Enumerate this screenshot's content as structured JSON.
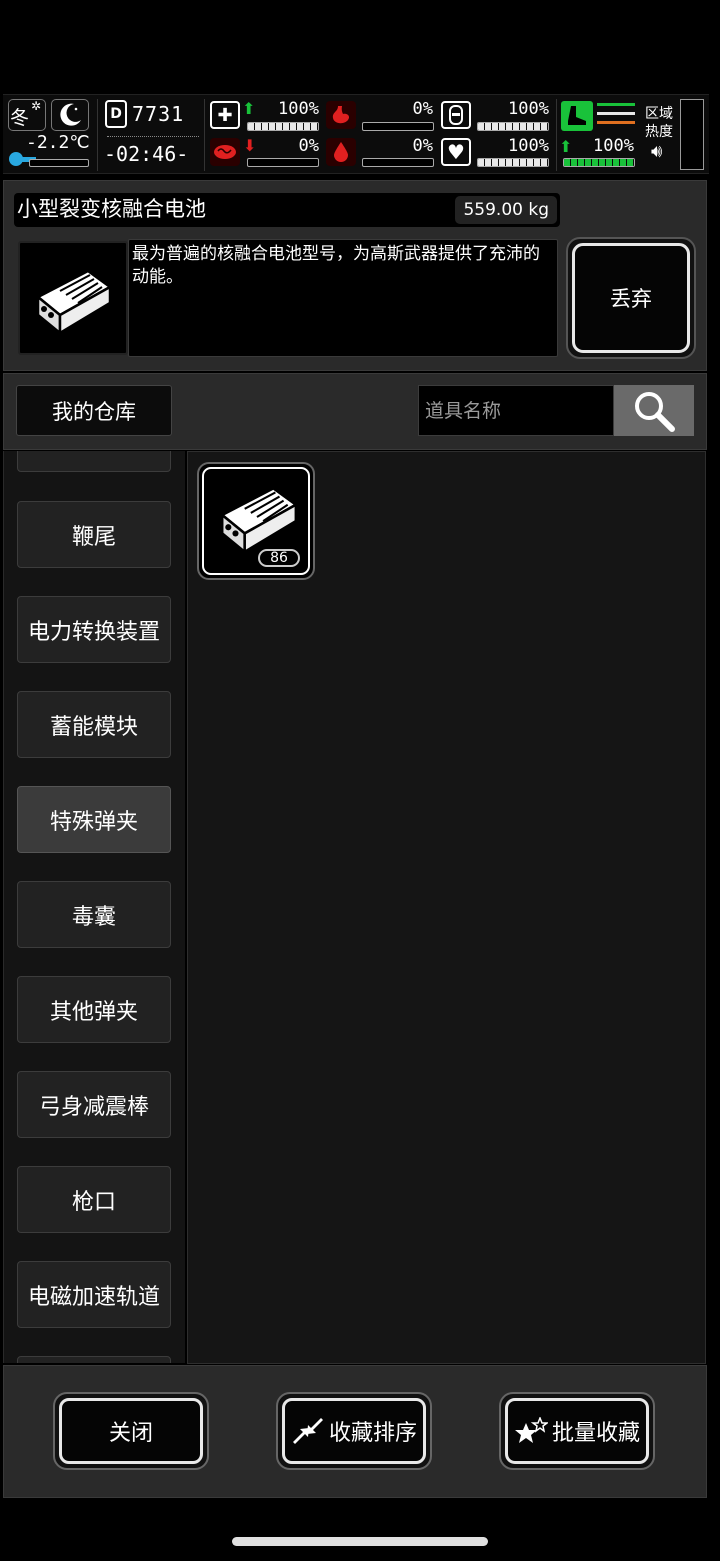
{
  "hud": {
    "season": "冬",
    "temperature": "-2.2℃",
    "day": "7731",
    "time": "-02:46-",
    "stats": {
      "health_pct": "100%",
      "hunger_pct": "0%",
      "hydration_pct": "100%",
      "brain_pct": "0%",
      "blood_pct": "0%",
      "heart_pct": "100%",
      "stamina_pct": "100%"
    },
    "zone_heat_label": "区域热度",
    "icons": [
      "snow-weather-icon",
      "moon-icon",
      "thermometer-icon",
      "day-counter-icon",
      "medkit-icon",
      "stomach-icon",
      "water-bottle-icon",
      "brain-icon",
      "blood-drop-icon",
      "heart-icon",
      "running-shoe-icon",
      "speaker-icon"
    ],
    "colors": {
      "good": "#19c23a",
      "bad": "#e02020",
      "bar": "#e8e8e8",
      "stamina_lines": [
        "#19c23a",
        "#e8e8e8",
        "#e07020"
      ]
    }
  },
  "item": {
    "name": "小型裂变核融合电池",
    "weight": "559.00 kg",
    "description": "最为普遍的核融合电池型号，为高斯武器提供了充沛的动能。",
    "discard_label": "丢弃"
  },
  "warehouse": {
    "tab_label": "我的仓库",
    "search_placeholder": "道具名称"
  },
  "categories": [
    {
      "label": ""
    },
    {
      "label": "鞭尾"
    },
    {
      "label": "电力转换装置"
    },
    {
      "label": "蓄能模块"
    },
    {
      "label": "特殊弹夹",
      "active": true
    },
    {
      "label": "毒囊"
    },
    {
      "label": "其他弹夹"
    },
    {
      "label": "弓身减震棒"
    },
    {
      "label": "枪口"
    },
    {
      "label": "电磁加速轨道"
    },
    {
      "label": ""
    }
  ],
  "grid_items": [
    {
      "icon": "battery-icon",
      "count": "86"
    }
  ],
  "bottom": {
    "close_label": "关闭",
    "sort_label": "收藏排序",
    "batch_label": "批量收藏"
  }
}
